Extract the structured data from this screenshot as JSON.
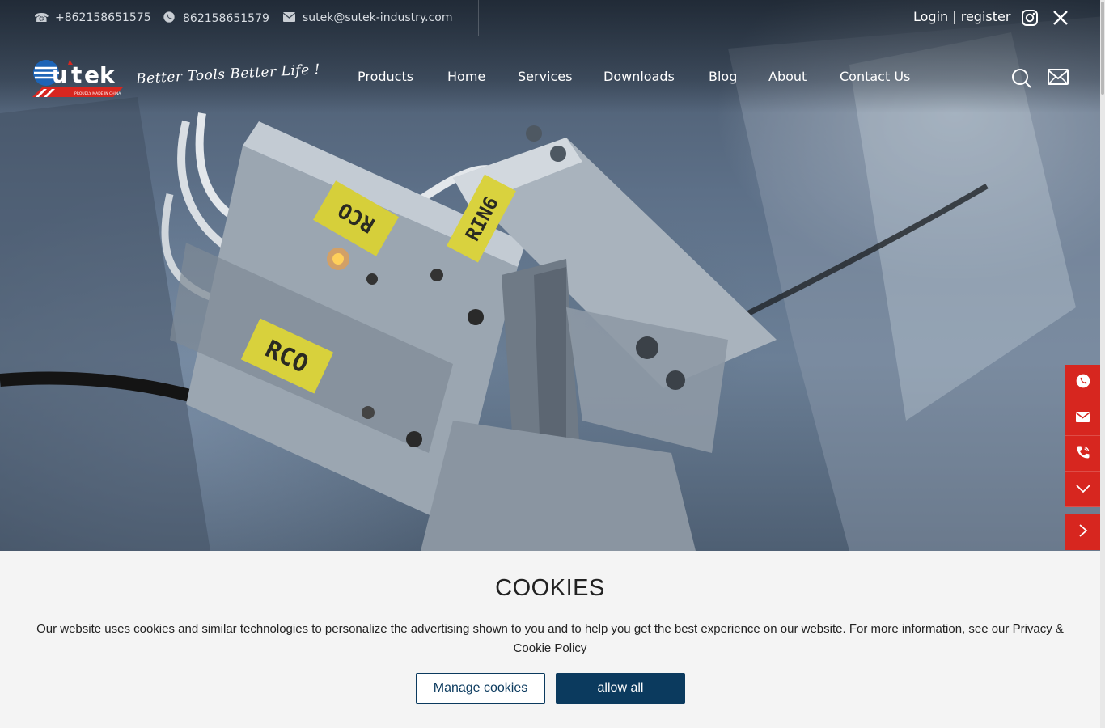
{
  "topbar": {
    "phone": "+862158651575",
    "whatsapp": "862158651579",
    "email": "sutek@sutek-industry.com",
    "login": "Login | register"
  },
  "brand": {
    "logo_text": "Sutek",
    "logo_subtext": "PROUDLY MADE IN CHINA",
    "tagline": "Better Tools Better Life !"
  },
  "nav": {
    "items": [
      "Products",
      "Home",
      "Services",
      "Downloads",
      "Blog",
      "About",
      "Contact Us"
    ]
  },
  "hero": {
    "labels": [
      "RCO",
      "RIN6",
      "RCO"
    ]
  },
  "sidebar_buttons": [
    "whatsapp-icon",
    "mail-icon",
    "phone-icon",
    "chevron-down-icon",
    "chevron-right-icon"
  ],
  "cookie": {
    "title": "COOKIES",
    "message": "Our website uses cookies and similar technologies to personalize the advertising shown to you and to help you get the best experience on our website. For more information, see our Privacy & Cookie Policy",
    "manage_label": "Manage cookies",
    "allow_label": "allow all"
  },
  "colors": {
    "accent_red": "#d7261f",
    "button_navy": "#0b3a5e",
    "cookie_bg": "#f4f4f4"
  }
}
